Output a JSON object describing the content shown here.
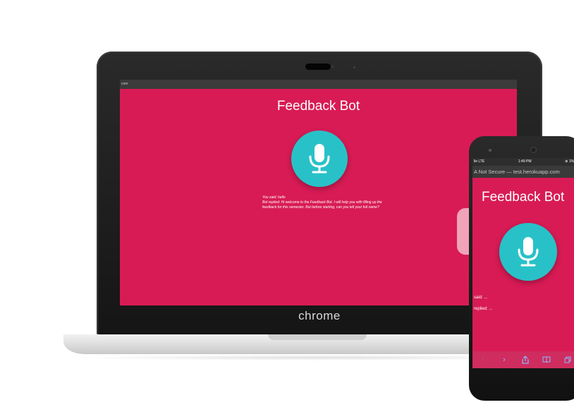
{
  "laptop": {
    "url_fragment": "com",
    "title": "Feedback Bot",
    "transcript": [
      "You said: hello",
      "Bot replied: Hi welcome to the Feedback Bot. I will help you with filling up the feedback for this semester. But before starting, can you tell your full name?"
    ],
    "brand": "chrome"
  },
  "phone": {
    "status_left": "lle LTE",
    "status_time": "1:49 PM",
    "status_right": "⊕ 1%",
    "url": "A  Not Secure — test.herokuapp.com",
    "title": "Feedback Bot",
    "said_line": "said: ...",
    "replied_line": "replied: ..."
  },
  "colors": {
    "page_bg": "#d81b55",
    "mic_bg": "#29c1c8",
    "toolbar_icon": "#8fb8ff"
  },
  "icons": {
    "mic": "microphone-icon",
    "back": "chevron-left-icon",
    "forward": "chevron-right-icon",
    "share": "share-icon",
    "bookmarks": "book-icon",
    "tabs": "tabs-icon"
  }
}
